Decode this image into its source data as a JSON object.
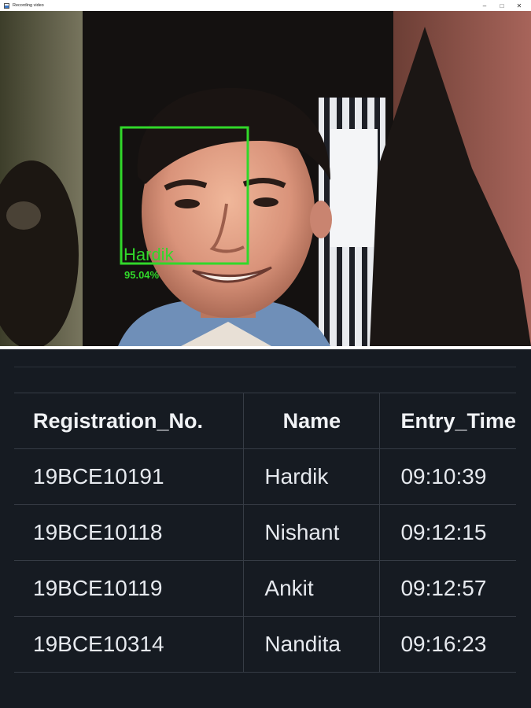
{
  "window": {
    "title": "Recording video",
    "controls": {
      "minimize": "–",
      "maximize": "□",
      "close": "✕"
    }
  },
  "video": {
    "detection": {
      "name": "Hardik",
      "confidence": "95.04%",
      "box_color": "#31d82a"
    }
  },
  "table": {
    "headers": [
      "Registration_No.",
      "Name",
      "Entry_Time"
    ],
    "rows": [
      [
        "19BCE10191",
        "Hardik",
        "09:10:39"
      ],
      [
        "19BCE10118",
        "Nishant",
        "09:12:15"
      ],
      [
        "19BCE10119",
        "Ankit",
        "09:12:57"
      ],
      [
        "19BCE10314",
        "Nandita",
        "09:16:23"
      ]
    ]
  },
  "colors": {
    "panel_background": "#161b22",
    "grid_line": "#363c45",
    "text": "#e6e9ee"
  }
}
